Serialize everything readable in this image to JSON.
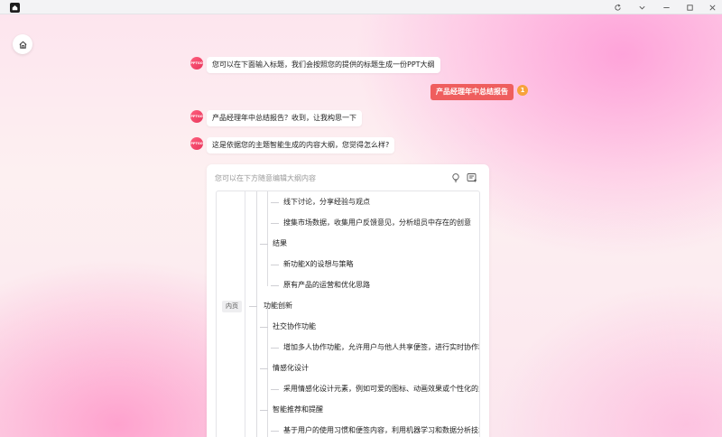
{
  "window": {
    "controls": [
      "refresh-icon",
      "chevron-down-icon",
      "minimize-icon",
      "maximize-icon",
      "close-icon"
    ]
  },
  "chat": {
    "avatar_text": "PPTGO",
    "messages": [
      {
        "role": "assistant",
        "text": "您可以在下面输入标题，我们会按照您的提供的标题生成一份PPT大纲"
      },
      {
        "role": "user",
        "text": "产品经理年中总结报告",
        "badge": "1"
      },
      {
        "role": "assistant",
        "text": "产品经理年中总结报告？收到，让我构思一下"
      },
      {
        "role": "assistant",
        "text": "这是依据您的主题智能生成的内容大纲，您觉得怎么样?"
      }
    ]
  },
  "outline": {
    "hint": "您可以在下方随意编辑大纲内容",
    "section_tag": "内页",
    "nodes": [
      {
        "level": 3,
        "text": "线下讨论，分享经验与观点"
      },
      {
        "level": 3,
        "text": "搜集市场数据，收集用户反馈意见，分析组员中存在的创意"
      },
      {
        "level": 2,
        "text": "结果"
      },
      {
        "level": 3,
        "text": "新功能X的设想与策略"
      },
      {
        "level": 3,
        "text": "原有产品的运营和优化思路"
      },
      {
        "level": 1,
        "text": "功能创新"
      },
      {
        "level": 2,
        "text": "社交协作功能"
      },
      {
        "level": 3,
        "text": "增加多人协作功能，允许用户与他人共享便签，进行实时协作和"
      },
      {
        "level": 2,
        "text": "情感化设计"
      },
      {
        "level": 3,
        "text": "采用情感化设计元素，例如可爱的图标、动画效果或个性化的主"
      },
      {
        "level": 2,
        "text": "智能推荐和提醒"
      },
      {
        "level": 3,
        "text": "基于用户的使用习惯和便签内容，利用机器学习和数据分析技术"
      }
    ]
  },
  "colors": {
    "accent": "#ef5e5e",
    "badge": "#f7a23b",
    "avatar": "#e8365b"
  }
}
